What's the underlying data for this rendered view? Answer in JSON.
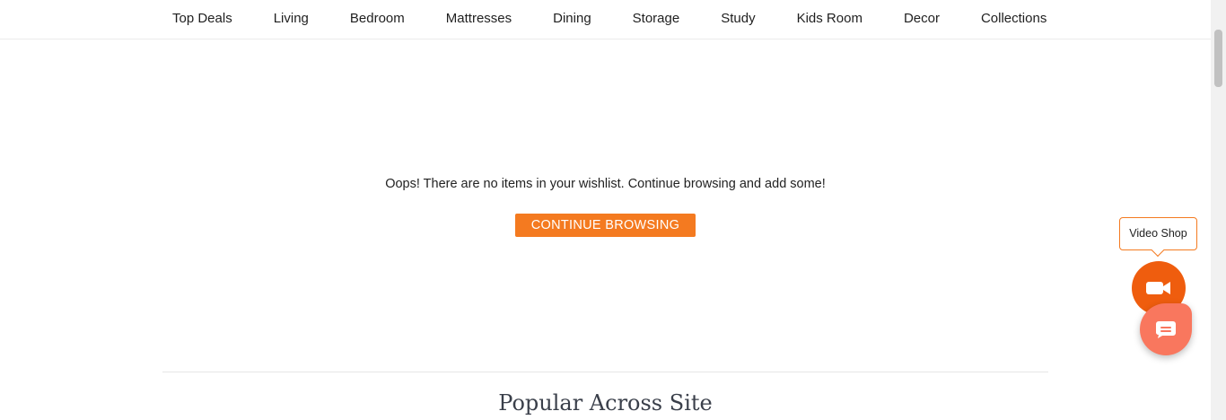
{
  "nav": {
    "items": [
      {
        "label": "Top Deals"
      },
      {
        "label": "Living"
      },
      {
        "label": "Bedroom"
      },
      {
        "label": "Mattresses"
      },
      {
        "label": "Dining"
      },
      {
        "label": "Storage"
      },
      {
        "label": "Study"
      },
      {
        "label": "Kids Room"
      },
      {
        "label": "Decor"
      },
      {
        "label": "Collections"
      }
    ]
  },
  "wishlist": {
    "empty_message": "Oops! There are no items in your wishlist. Continue browsing and add some!",
    "cta_label": "CONTINUE BROWSING"
  },
  "popular": {
    "title": "Popular Across Site"
  },
  "widgets": {
    "video_shop_label": "Video Shop",
    "video_icon": "video-camera-icon",
    "chat_icon": "chat-bubble-icon"
  },
  "colors": {
    "accent": "#f47a20",
    "video_fab": "#ef5d0e",
    "chat_fab": "#f9775e"
  }
}
